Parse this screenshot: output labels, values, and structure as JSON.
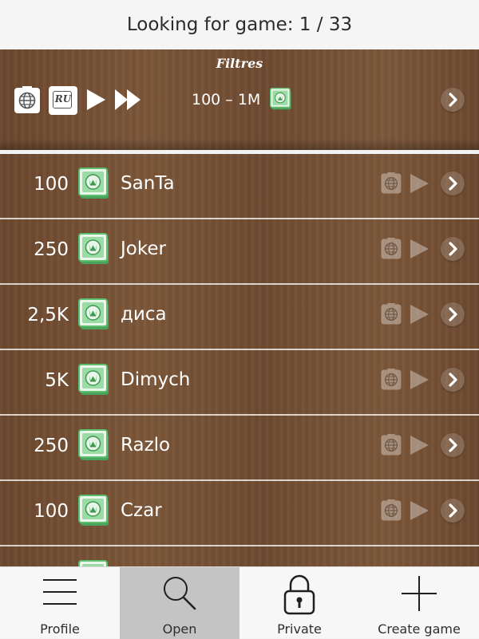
{
  "header": {
    "title": "Looking for game: 1 / 33"
  },
  "filters": {
    "title": "Filtres",
    "region_badge": "RU",
    "bet_range": "100 – 1M"
  },
  "games": [
    {
      "amount": "100",
      "player": "SanTa"
    },
    {
      "amount": "250",
      "player": "Joker"
    },
    {
      "amount": "2,5K",
      "player": "диса"
    },
    {
      "amount": "5K",
      "player": "Dimych"
    },
    {
      "amount": "250",
      "player": "Razlo"
    },
    {
      "amount": "100",
      "player": "Czar"
    }
  ],
  "tabs": [
    {
      "label": "Profile",
      "icon": "menu-icon"
    },
    {
      "label": "Open",
      "icon": "search-icon",
      "active": true
    },
    {
      "label": "Private",
      "icon": "lock-icon"
    },
    {
      "label": "Create game",
      "icon": "plus-icon"
    }
  ],
  "colors": {
    "wood": "#6f4c32",
    "money_green": "#5cbf6f",
    "active_tab": "#c4c4c4"
  }
}
